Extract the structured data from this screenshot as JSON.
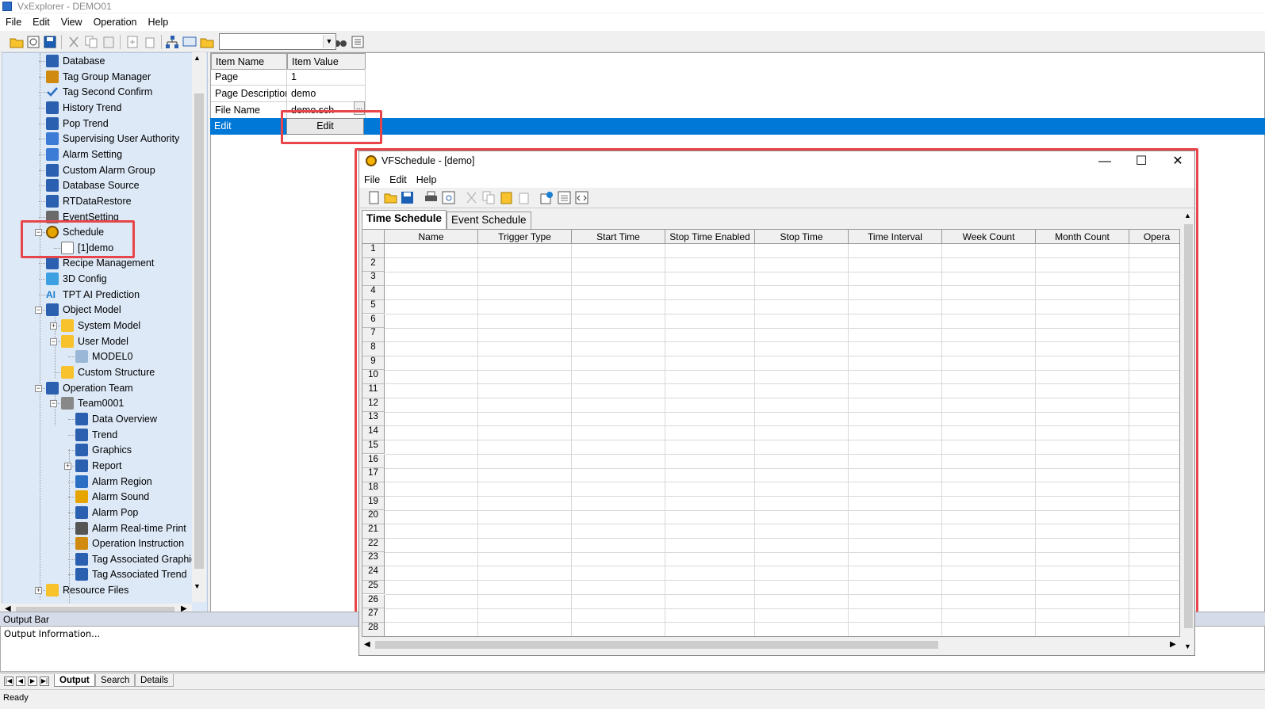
{
  "app": {
    "title": "VxExplorer - DEMO01"
  },
  "menu": [
    "File",
    "Edit",
    "View",
    "Operation",
    "Help"
  ],
  "tree": {
    "items": [
      {
        "label": "Database",
        "icon": "database-icon",
        "color": "#2b5fb0"
      },
      {
        "label": "Tag Group Manager",
        "icon": "tag-group-icon",
        "color": "#d08a10"
      },
      {
        "label": "Tag Second Confirm",
        "icon": "checkmark-icon",
        "color": "#2b6fc4"
      },
      {
        "label": "History Trend",
        "icon": "history-trend-icon",
        "color": "#2b5fb0"
      },
      {
        "label": "Pop Trend",
        "icon": "pop-trend-icon",
        "color": "#2b5fb0"
      },
      {
        "label": "Supervising User Authority",
        "icon": "user-icon",
        "color": "#3d7cd6"
      },
      {
        "label": "Alarm Setting",
        "icon": "alarm-setting-icon",
        "color": "#3d7cd6"
      },
      {
        "label": "Custom Alarm Group",
        "icon": "alarm-group-icon",
        "color": "#2b5fb0"
      },
      {
        "label": "Database Source",
        "icon": "database-source-icon",
        "color": "#2b5fb0"
      },
      {
        "label": "RTDataRestore",
        "icon": "restore-icon",
        "color": "#2b5fb0"
      },
      {
        "label": "EventSetting",
        "icon": "event-icon",
        "color": "#6a6a6a"
      },
      {
        "label": "Schedule",
        "icon": "schedule-clock-icon",
        "color": "#e6a400"
      },
      {
        "label": "[1]demo",
        "icon": "document-icon",
        "color": "#ffffff"
      },
      {
        "label": "Recipe Management",
        "icon": "recipe-icon",
        "color": "#2b5fb0"
      },
      {
        "label": "3D Config",
        "icon": "cube-icon",
        "color": "#3da0e0"
      },
      {
        "label": "TPT AI Prediction",
        "icon": "ai-icon",
        "color": "#1a7fd0"
      },
      {
        "label": "Object Model",
        "icon": "object-model-icon",
        "color": "#2b5fb0"
      },
      {
        "label": "System Model",
        "icon": "folder-icon",
        "color": "#f7c22b"
      },
      {
        "label": "User Model",
        "icon": "folder-icon",
        "color": "#f7c22b"
      },
      {
        "label": "MODEL0",
        "icon": "model-cube-icon",
        "color": "#9ab7d8"
      },
      {
        "label": "Custom Structure",
        "icon": "folder-icon",
        "color": "#f7c22b"
      },
      {
        "label": "Operation Team",
        "icon": "team-icon",
        "color": "#2b5fb0"
      },
      {
        "label": "Team0001",
        "icon": "team-member-icon",
        "color": "#888888"
      },
      {
        "label": "Data Overview",
        "icon": "grid-icon",
        "color": "#2b5fb0"
      },
      {
        "label": "Trend",
        "icon": "trend-icon",
        "color": "#2b5fb0"
      },
      {
        "label": "Graphics",
        "icon": "graphics-icon",
        "color": "#2b5fb0"
      },
      {
        "label": "Report",
        "icon": "report-icon",
        "color": "#2b5fb0"
      },
      {
        "label": "Alarm Region",
        "icon": "alarm-region-icon",
        "color": "#2b6fc4"
      },
      {
        "label": "Alarm Sound",
        "icon": "speaker-icon",
        "color": "#e6a400"
      },
      {
        "label": "Alarm Pop",
        "icon": "alarm-pop-icon",
        "color": "#2b5fb0"
      },
      {
        "label": "Alarm Real-time Print",
        "icon": "printer-icon",
        "color": "#555555"
      },
      {
        "label": "Operation Instruction",
        "icon": "instruction-icon",
        "color": "#d08a10"
      },
      {
        "label": "Tag Associated Graphics",
        "icon": "tag-graphics-icon",
        "color": "#2b5fb0"
      },
      {
        "label": "Tag Associated Trend",
        "icon": "tag-trend-icon",
        "color": "#2b5fb0"
      },
      {
        "label": "Resource Files",
        "icon": "resource-folder-icon",
        "color": "#f7c22b"
      }
    ]
  },
  "properties": {
    "header": {
      "name": "Item Name",
      "value": "Item Value"
    },
    "rows": [
      {
        "name": "Page",
        "value": "1"
      },
      {
        "name": "Page Description",
        "value": "demo"
      },
      {
        "name": "File Name",
        "value": "demo.sch"
      },
      {
        "name": "Edit",
        "value": "Edit"
      }
    ],
    "ellipsis": "..."
  },
  "output": {
    "title": "Output Bar",
    "text": "Output Information...",
    "tabs": [
      "Output",
      "Search",
      "Details"
    ]
  },
  "status": {
    "text": "Ready"
  },
  "vfschedule": {
    "title": "VFSchedule - [demo]",
    "menu": [
      "File",
      "Edit",
      "Help"
    ],
    "tabs": [
      "Time Schedule",
      "Event Schedule"
    ],
    "columns": [
      "Name",
      "Trigger Type",
      "Start Time",
      "Stop Time Enabled",
      "Stop Time",
      "Time Interval",
      "Week Count",
      "Month Count",
      "Opera"
    ],
    "row_count": 28,
    "window_buttons": {
      "minimize": "—",
      "maximize": "☐",
      "close": "✕"
    }
  },
  "colors": {
    "highlight": "#e8454a",
    "selection": "#0078d7",
    "tree_bg": "#dde9f7"
  }
}
